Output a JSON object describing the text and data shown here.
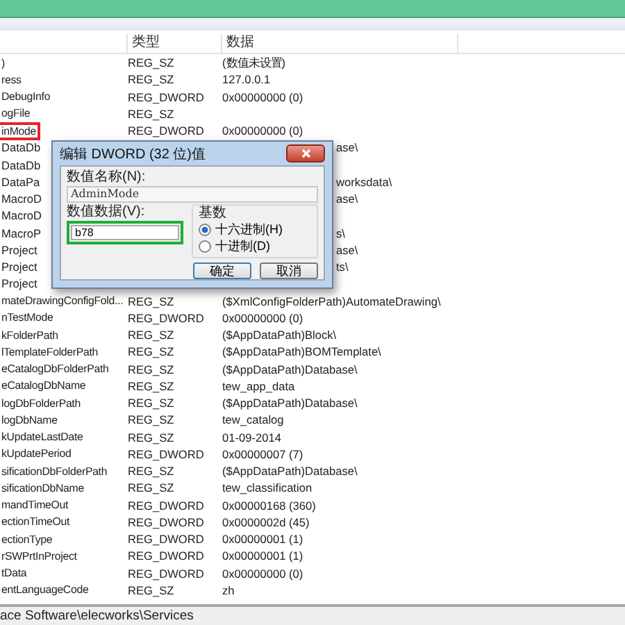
{
  "table": {
    "columns": [
      "类型",
      "数据"
    ],
    "rows": [
      {
        "kind": "normal",
        "name": ")",
        "type": "REG_SZ",
        "data": "(数值未设置)",
        "marked": false
      },
      {
        "kind": "normal",
        "name": "ress",
        "type": "REG_SZ",
        "data": "127.0.0.1",
        "marked": false
      },
      {
        "kind": "normal",
        "name": "DebugInfo",
        "type": "REG_DWORD",
        "data": "0x00000000 (0)",
        "marked": false
      },
      {
        "kind": "normal",
        "name": "ogFile",
        "type": "REG_SZ",
        "data": "",
        "marked": false
      },
      {
        "kind": "normal",
        "name": "inMode",
        "type": "REG_DWORD",
        "data": "0x00000000 (0)",
        "marked": true
      },
      {
        "kind": "covered",
        "name": "DataDb",
        "data": "ase\\"
      },
      {
        "kind": "covered",
        "name": "DataDb",
        "data": ""
      },
      {
        "kind": "covered",
        "name": "DataPa",
        "data": "worksdata\\"
      },
      {
        "kind": "covered",
        "name": "MacroD",
        "data": "ase\\"
      },
      {
        "kind": "covered",
        "name": "MacroD",
        "data": ""
      },
      {
        "kind": "covered",
        "name": "MacroP",
        "data": "s\\"
      },
      {
        "kind": "covered",
        "name": "Project",
        "data": "ase\\"
      },
      {
        "kind": "covered",
        "name": "Project",
        "data": "ts\\"
      },
      {
        "kind": "covered",
        "name": "Project",
        "data": ""
      },
      {
        "kind": "normal",
        "name": "mateDrawingConfigFold...",
        "type": "REG_SZ",
        "data": "($XmlConfigFolderPath)AutomateDrawing\\",
        "marked": false
      },
      {
        "kind": "normal",
        "name": "nTestMode",
        "type": "REG_DWORD",
        "data": "0x00000000 (0)",
        "marked": false
      },
      {
        "kind": "normal",
        "name": "kFolderPath",
        "type": "REG_SZ",
        "data": "($AppDataPath)Block\\",
        "marked": false
      },
      {
        "kind": "normal",
        "name": "lTemplateFolderPath",
        "type": "REG_SZ",
        "data": "($AppDataPath)BOMTemplate\\",
        "marked": false
      },
      {
        "kind": "normal",
        "name": "eCatalogDbFolderPath",
        "type": "REG_SZ",
        "data": "($AppDataPath)Database\\",
        "marked": false
      },
      {
        "kind": "normal",
        "name": "eCatalogDbName",
        "type": "REG_SZ",
        "data": "tew_app_data",
        "marked": false
      },
      {
        "kind": "normal",
        "name": "logDbFolderPath",
        "type": "REG_SZ",
        "data": "($AppDataPath)Database\\",
        "marked": false
      },
      {
        "kind": "normal",
        "name": "logDbName",
        "type": "REG_SZ",
        "data": "tew_catalog",
        "marked": false
      },
      {
        "kind": "normal",
        "name": "kUpdateLastDate",
        "type": "REG_SZ",
        "data": "01-09-2014",
        "marked": false
      },
      {
        "kind": "normal",
        "name": "kUpdatePeriod",
        "type": "REG_DWORD",
        "data": "0x00000007 (7)",
        "marked": false
      },
      {
        "kind": "normal",
        "name": "sificationDbFolderPath",
        "type": "REG_SZ",
        "data": "($AppDataPath)Database\\",
        "marked": false
      },
      {
        "kind": "normal",
        "name": "sificationDbName",
        "type": "REG_SZ",
        "data": "tew_classification",
        "marked": false
      },
      {
        "kind": "normal",
        "name": "mandTimeOut",
        "type": "REG_DWORD",
        "data": "0x00000168 (360)",
        "marked": false
      },
      {
        "kind": "normal",
        "name": "ectionTimeOut",
        "type": "REG_DWORD",
        "data": "0x0000002d (45)",
        "marked": false
      },
      {
        "kind": "normal",
        "name": "ectionType",
        "type": "REG_DWORD",
        "data": "0x00000001 (1)",
        "marked": false
      },
      {
        "kind": "normal",
        "name": "rSWPrtInProject",
        "type": "REG_DWORD",
        "data": "0x00000001 (1)",
        "marked": false
      },
      {
        "kind": "normal",
        "name": "tData",
        "type": "REG_DWORD",
        "data": "0x00000000 (0)",
        "marked": false
      },
      {
        "kind": "normal",
        "name": "entLanguageCode",
        "type": "REG_SZ",
        "data": "zh",
        "marked": false
      }
    ]
  },
  "dialog": {
    "title": "编辑 DWORD (32 位)值",
    "name_label": "数值名称(N):",
    "name_value": "AdminMode",
    "data_label": "数值数据(V):",
    "data_value": "b78",
    "data_marked": true,
    "base_label": "基数",
    "radios": [
      {
        "label": "十六进制(H)",
        "selected": true
      },
      {
        "label": "十进制(D)",
        "selected": false
      }
    ],
    "buttons": [
      "确定",
      "取消"
    ]
  },
  "status_bar": "ace Software\\elecworks\\Services"
}
